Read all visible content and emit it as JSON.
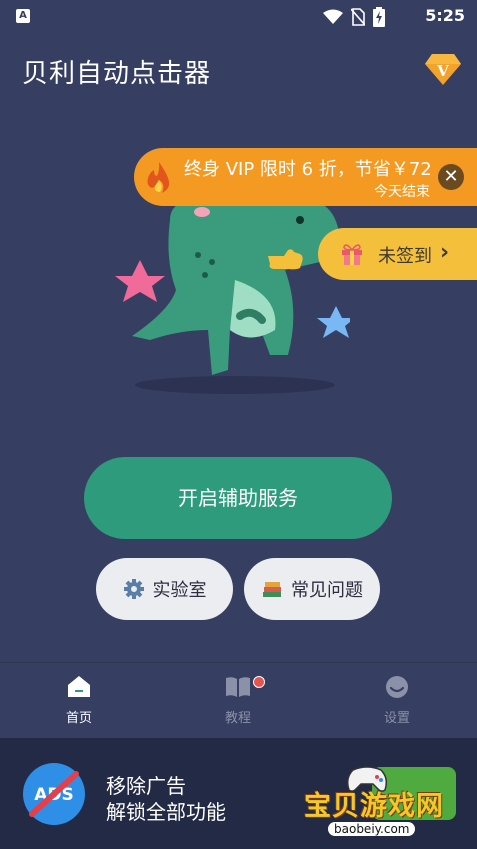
{
  "status_bar": {
    "notification_glyph": "A",
    "time": "5:25"
  },
  "app": {
    "title": "贝利自动点击器",
    "vip_badge_glyph": "V"
  },
  "promo": {
    "main": "终身 VIP 限时 6 折，节省￥72",
    "sub": "今天结束"
  },
  "signin": {
    "label": "未签到"
  },
  "main": {
    "start_button": "开启辅助服务",
    "lab_button": "实验室",
    "faq_button": "常见问题"
  },
  "tabs": [
    {
      "label": "首页"
    },
    {
      "label": "教程"
    },
    {
      "label": "设置"
    }
  ],
  "ad": {
    "icon_text": "ADS",
    "line1": "移除广告",
    "line2": "解锁全部功能"
  },
  "watermark": {
    "text": "宝贝游戏网",
    "url": "baobeiy.com"
  },
  "colors": {
    "background": "#363e62",
    "primary": "#2e9b7d",
    "promo": "#f49a22",
    "signin": "#f4c03c",
    "ad_bar": "#232a45"
  }
}
